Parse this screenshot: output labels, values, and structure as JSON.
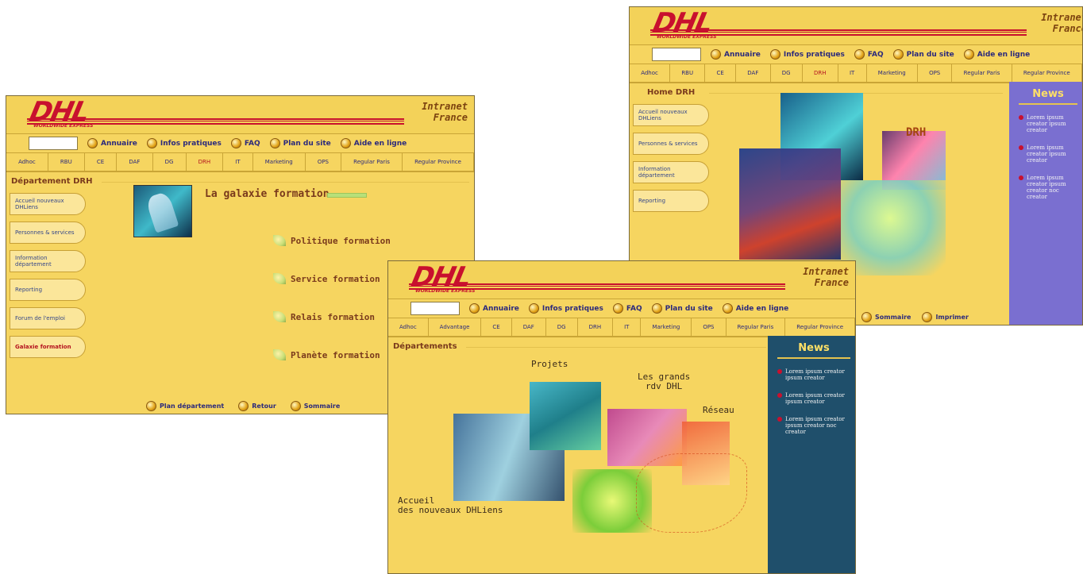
{
  "brand": {
    "logo_text": "DHL",
    "logo_tagline": "WORLDWIDE EXPRESS",
    "intranet_line1": "Intranet",
    "intranet_line2": "France",
    "red": "#c8102e",
    "yellow": "#f6d560"
  },
  "toolbar": {
    "search_placeholder": "",
    "items": [
      {
        "label": "Annuaire",
        "icon": "person-icon"
      },
      {
        "label": "Infos pratiques",
        "icon": "info-icon"
      },
      {
        "label": "FAQ",
        "icon": "faq-icon"
      },
      {
        "label": "Plan du site",
        "icon": "sitemap-icon"
      },
      {
        "label": "Aide en ligne",
        "icon": "help-icon"
      }
    ]
  },
  "tabs_left": [
    "Adhoc",
    "RBU",
    "CE",
    "DAF",
    "DG",
    "DRH",
    "IT",
    "Marketing",
    "OPS",
    "Regular Paris",
    "Regular Province"
  ],
  "tabs_center": [
    "Adhoc",
    "Advantage",
    "CE",
    "DAF",
    "DG",
    "DRH",
    "IT",
    "Marketing",
    "OPS",
    "Regular Paris",
    "Regular Province"
  ],
  "left_screen": {
    "section_title": "Département DRH",
    "menu": [
      "Accueil nouveaux DHLiens",
      "Personnes & services",
      "Information département",
      "Reporting",
      "Forum de l'emploi",
      "Galaxie formation"
    ],
    "gallery_title": "La galaxie formation",
    "gallery_links": [
      "Politique formation",
      "Service formation",
      "Relais formation",
      "Planète formation"
    ],
    "bottom": [
      {
        "label": "Plan département",
        "icon": "plus-icon"
      },
      {
        "label": "Retour",
        "icon": "back-arrow-icon"
      },
      {
        "label": "Sommaire",
        "icon": "summary-icon"
      }
    ]
  },
  "right_screen": {
    "section_title": "Home DRH",
    "menu": [
      "Accueil nouveaux DHLiens",
      "Personnes & services",
      "Information département",
      "Reporting"
    ],
    "center_label": "DRH",
    "news_title": "News",
    "news": [
      "Lorem ipsum creator ipsum creator",
      "Lorem ipsum creator ipsum creator",
      "Lorem ipsum creator ipsum creator noc creator"
    ],
    "bottom": [
      {
        "label": "Sommaire",
        "icon": "summary-icon"
      },
      {
        "label": "Imprimer",
        "icon": "print-icon"
      }
    ]
  },
  "center_screen": {
    "section_title": "Départements",
    "labels": {
      "projets": "Projets",
      "grands_line1": "Les grands",
      "grands_line2": "rdv DHL",
      "reseau": "Réseau",
      "accueil_line1": "Accueil",
      "accueil_line2": "des nouveaux DHLiens"
    },
    "news_title": "News",
    "news": [
      "Lorem ipsum creator ipsum creator",
      "Lorem ipsum creator ipsum creator",
      "Lorem ipsum creator ipsum creator noc creator"
    ]
  }
}
